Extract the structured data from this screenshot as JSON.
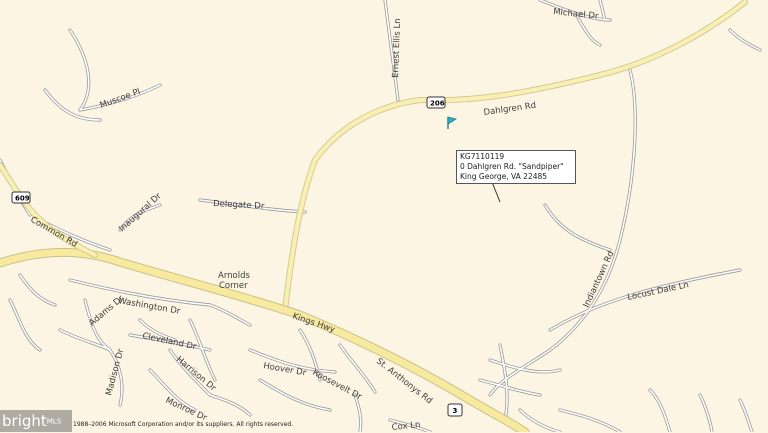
{
  "roads": {
    "ernest_ellis": "Ernest Ellis Ln",
    "michael": "Michael Dr",
    "muscoe": "Muscoe Pl",
    "dahlgren": "Dahlgren Rd",
    "delegate": "Delegate Dr",
    "inaugural": "Inaugural Dr",
    "common": "Common Rd",
    "kings_hwy": "Kings Hwy",
    "washington": "Washington Dr",
    "adams": "Adams Dr",
    "cleveland": "Cleveland Dr",
    "madison": "Madison Dr",
    "harrison": "Harrison Dr",
    "monroe": "Monroe Dr",
    "hoover": "Hoover Dr",
    "roosevelt": "Roosevelt Dr",
    "st_anthonys": "St. Anthonys Rd",
    "cox": "Cox Ln",
    "indiantown": "Indiantown Rd",
    "locust_dale": "Locust Dale Ln"
  },
  "places": {
    "arnolds_corner_1": "Arnolds",
    "arnolds_corner_2": "Corner"
  },
  "shields": {
    "r206": "206",
    "r609": "609",
    "r3": "3"
  },
  "callout": {
    "line1": "KG7110119",
    "line2": "0 Dahlgren Rd. \"Sandpiper\"",
    "line3": "King George, VA 22485"
  },
  "watermark": {
    "text": "bright",
    "suffix": "MLS"
  },
  "copyright": "1988–2006 Microsoft Corporation and/or its suppliers. All rights reserved.",
  "colors": {
    "land": "#fdf5e3",
    "major_road": "#f7ea9e",
    "minor_road": "#ffffff",
    "marker": "#2bb3c0"
  },
  "marker_icon": "flag-icon"
}
